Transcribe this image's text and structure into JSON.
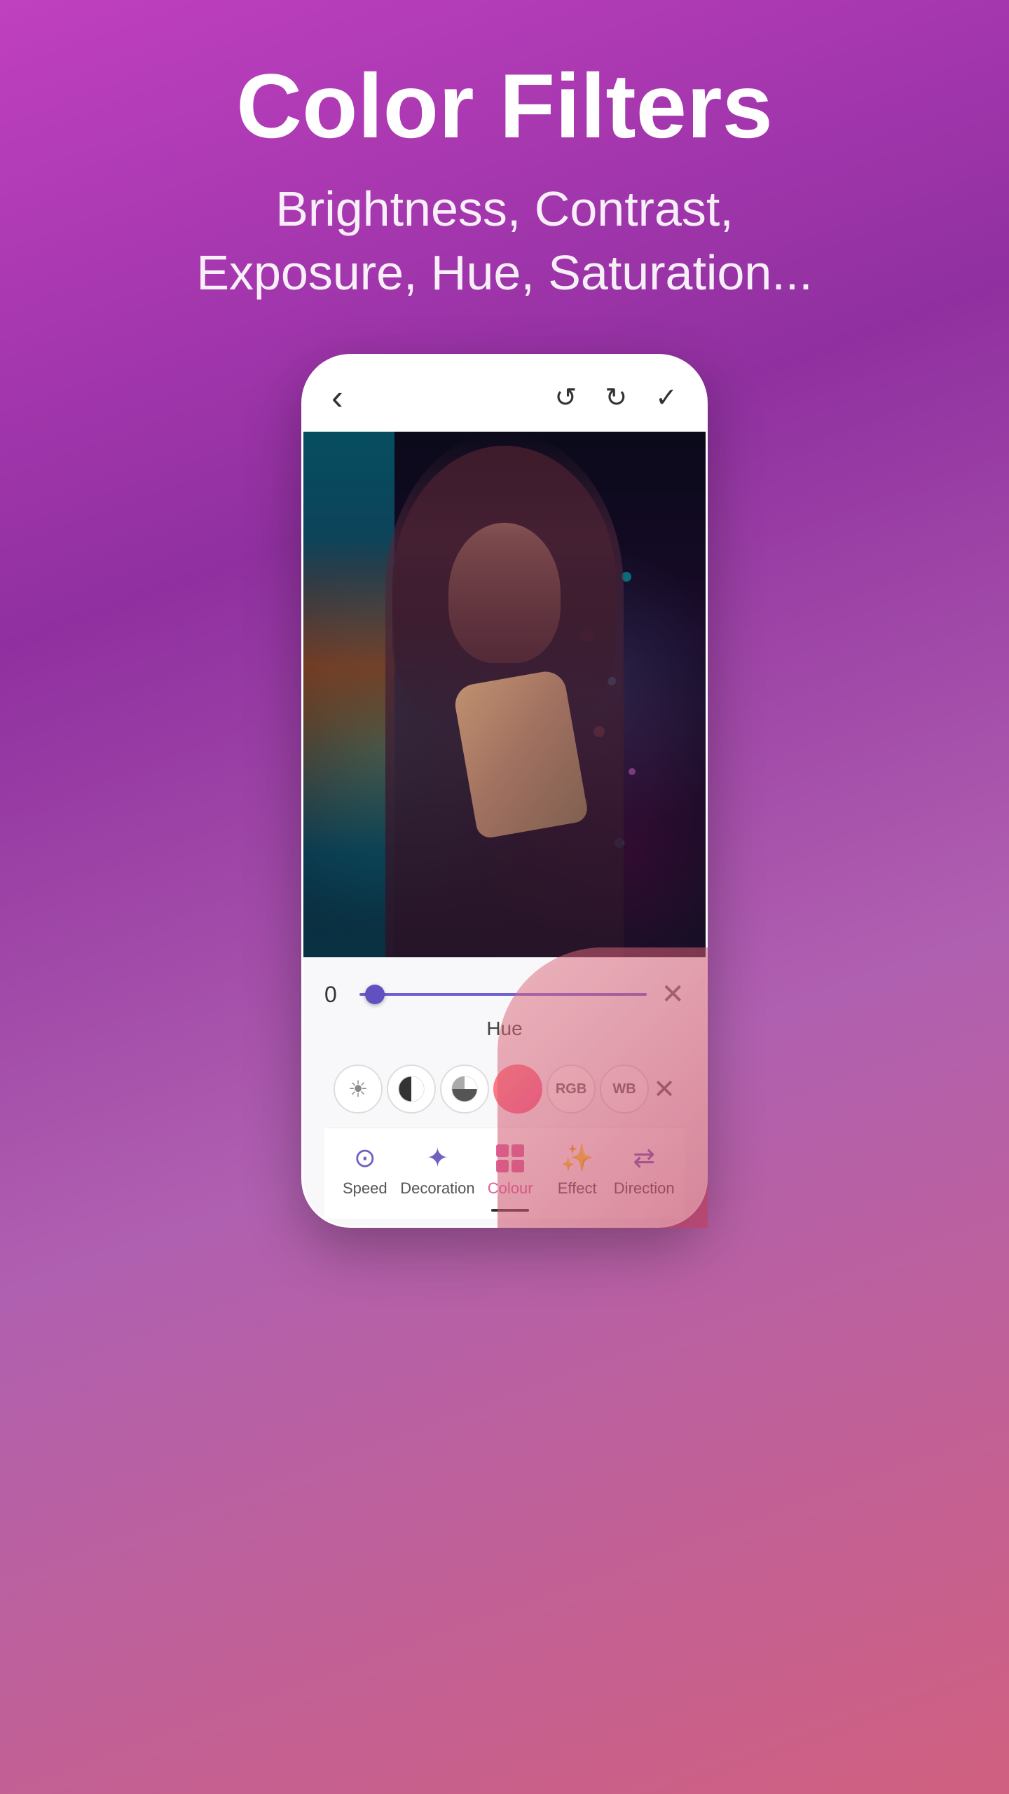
{
  "header": {
    "title": "Color Filters",
    "subtitle": "Brightness, Contrast,\nExposure, Hue, Saturation..."
  },
  "phone": {
    "topbar": {
      "back_label": "‹",
      "undo_label": "↺",
      "redo_label": "↻",
      "confirm_label": "✓"
    },
    "controls": {
      "slider_value": "0",
      "slider_label": "Hue",
      "close_label": "✕"
    },
    "filter_icons": [
      {
        "name": "brightness",
        "symbol": "☀"
      },
      {
        "name": "contrast",
        "symbol": "◐"
      },
      {
        "name": "exposure",
        "symbol": "⊕"
      },
      {
        "name": "hue",
        "symbol": "●"
      },
      {
        "name": "rgb",
        "symbol": "RGB"
      },
      {
        "name": "wb",
        "symbol": "WB"
      },
      {
        "name": "close",
        "symbol": "✕"
      }
    ],
    "bottom_nav": [
      {
        "id": "speed",
        "label": "Speed",
        "icon": "⊙",
        "active": false
      },
      {
        "id": "decoration",
        "label": "Decoration",
        "icon": "✦",
        "active": false
      },
      {
        "id": "colour",
        "label": "Colour",
        "icon": "⊞",
        "active": true
      },
      {
        "id": "effect",
        "label": "Effect",
        "icon": "✨",
        "active": false
      },
      {
        "id": "direction",
        "label": "Direction",
        "icon": "⇄",
        "active": false
      }
    ]
  },
  "colors": {
    "background_start": "#c040c0",
    "background_end": "#d06080",
    "accent": "#7060d0",
    "active_tab": "#e060a0"
  }
}
